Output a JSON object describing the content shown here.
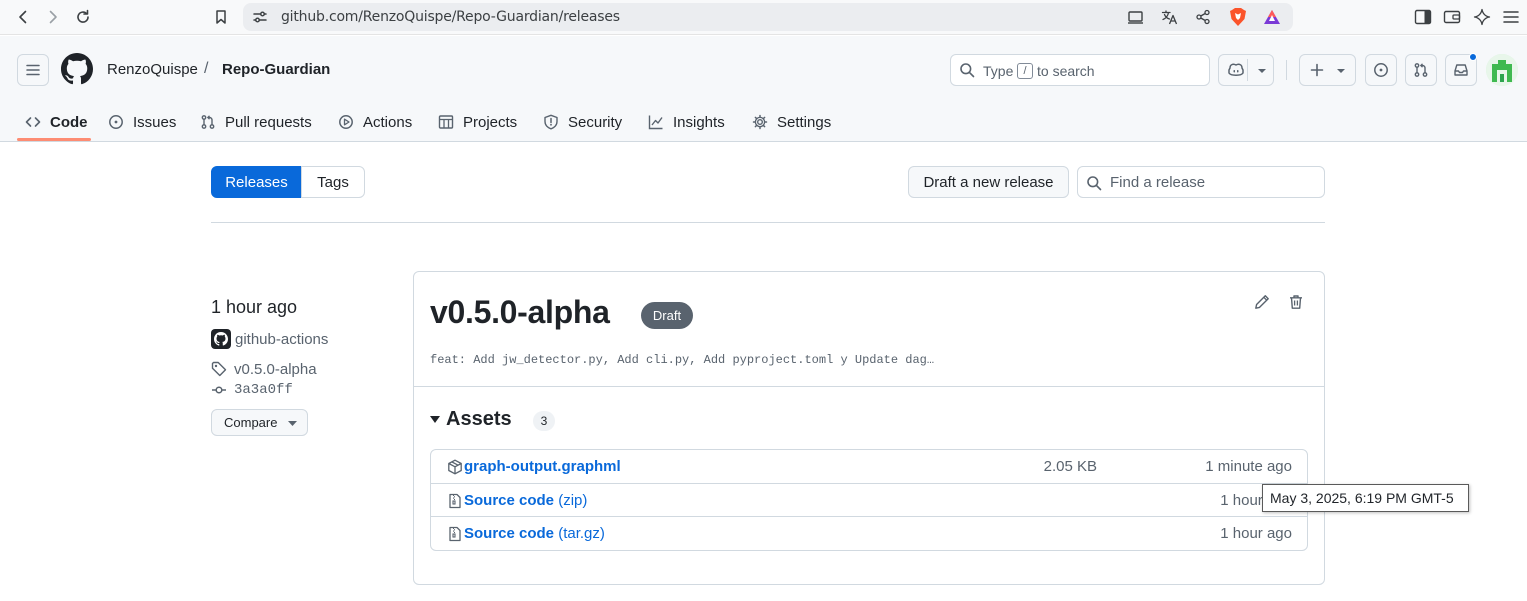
{
  "browser": {
    "url": "github.com/RenzoQuispe/Repo-Guardian/releases"
  },
  "header": {
    "owner": "RenzoQuispe",
    "separator": "/",
    "repo": "Repo-Guardian",
    "search": {
      "prefix": "Type",
      "key": "/",
      "suffix": "to search"
    }
  },
  "nav": {
    "items": [
      {
        "label": "Code",
        "icon": "code-icon",
        "active": true
      },
      {
        "label": "Issues",
        "icon": "issue-icon"
      },
      {
        "label": "Pull requests",
        "icon": "pull-request-icon"
      },
      {
        "label": "Actions",
        "icon": "play-icon"
      },
      {
        "label": "Projects",
        "icon": "table-icon"
      },
      {
        "label": "Security",
        "icon": "shield-icon"
      },
      {
        "label": "Insights",
        "icon": "graph-icon"
      },
      {
        "label": "Settings",
        "icon": "gear-icon"
      }
    ],
    "accent": "#fd8c73"
  },
  "subnav": {
    "releases_label": "Releases",
    "tags_label": "Tags",
    "draft_label": "Draft a new release",
    "find_placeholder": "Find a release"
  },
  "release": {
    "time": "1 hour ago",
    "author": "github-actions",
    "tag": "v0.5.0-alpha",
    "commit": "3a3a0ff",
    "compare_label": "Compare",
    "title": "v0.5.0-alpha",
    "badge": "Draft",
    "description": "feat: Add jw_detector.py, Add cli.py, Add pyproject.toml y Update dag…",
    "assets_label": "Assets",
    "assets_count": "3",
    "assets": [
      {
        "name": "graph-output.graphml",
        "suffix": "",
        "size": "2.05 KB",
        "time": "1 minute ago"
      },
      {
        "name": "Source code",
        "suffix": "(zip)",
        "size": "",
        "time": "1 hour ago"
      },
      {
        "name": "Source code",
        "suffix": "(tar.gz)",
        "size": "",
        "time": "1 hour ago"
      }
    ]
  },
  "tooltip": {
    "text": "May 3, 2025, 6:19 PM GMT-5"
  },
  "colors": {
    "primary": "#0969da",
    "badge": "#59636e",
    "border": "#d1d9e0"
  }
}
